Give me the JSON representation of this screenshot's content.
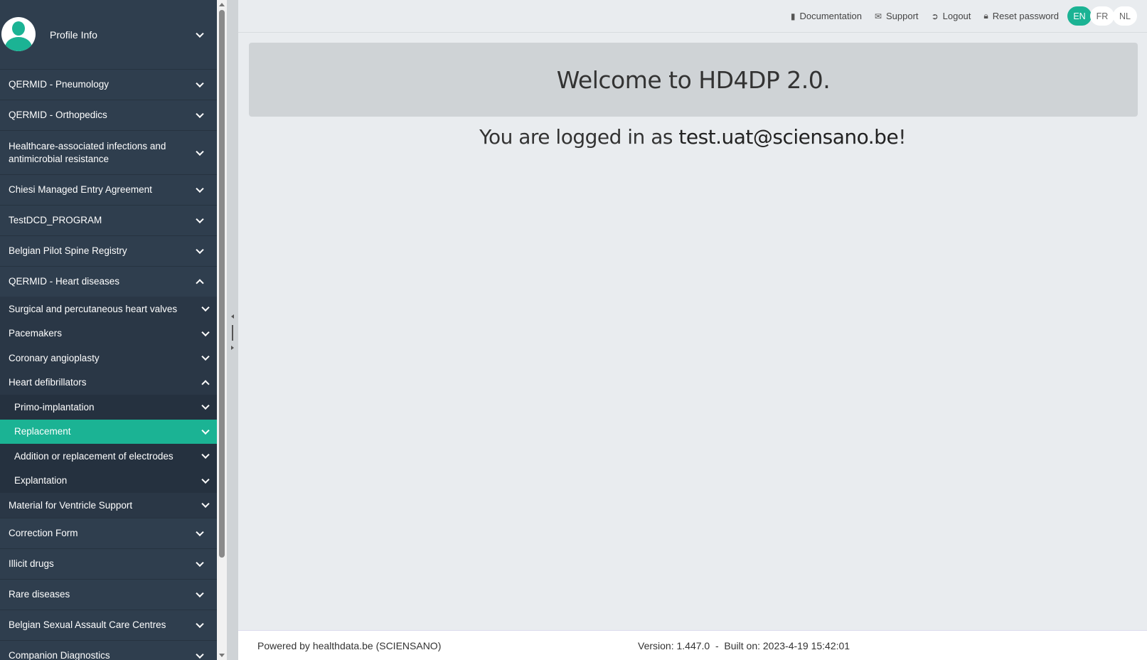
{
  "sidebar": {
    "profile_label": "Profile Info",
    "menu": [
      {
        "label": "QERMID - Pneumology"
      },
      {
        "label": "QERMID - Orthopedics"
      },
      {
        "label": "Healthcare-associated infections and antimicrobial resistance"
      },
      {
        "label": "Chiesi Managed Entry Agreement"
      },
      {
        "label": "TestDCD_PROGRAM"
      },
      {
        "label": "Belgian Pilot Spine Registry"
      },
      {
        "label": "QERMID - Heart diseases"
      }
    ],
    "heart_sub": [
      {
        "label": "Surgical and percutaneous heart valves"
      },
      {
        "label": "Pacemakers"
      },
      {
        "label": "Coronary angioplasty"
      },
      {
        "label": "Heart defibrillators"
      }
    ],
    "defib_sub": [
      {
        "label": "Primo-implantation"
      },
      {
        "label": "Replacement"
      },
      {
        "label": "Addition or replacement of electrodes"
      },
      {
        "label": "Explantation"
      }
    ],
    "heart_sub_after": [
      {
        "label": "Material for Ventricle Support"
      }
    ],
    "menu_after": [
      {
        "label": "Correction Form"
      },
      {
        "label": "Illicit drugs"
      },
      {
        "label": "Rare diseases"
      },
      {
        "label": "Belgian Sexual Assault Care Centres"
      },
      {
        "label": "Companion Diagnostics"
      }
    ],
    "active_item": "Replacement"
  },
  "topbar": {
    "documentation": "Documentation",
    "support": "Support",
    "logout": "Logout",
    "reset_password": "Reset password",
    "languages": [
      "EN",
      "FR",
      "NL"
    ],
    "active_language": "EN"
  },
  "main": {
    "welcome": "Welcome to HD4DP 2.0.",
    "logged_prefix": "You are logged in as ",
    "user_email": "test.uat@sciensano.be",
    "logged_suffix": "!"
  },
  "footer": {
    "powered_by": "Powered by healthdata.be (SCIENSANO)",
    "version": "Version: 1.447.0  -  Built on: 2023-4-19 15:42:01"
  },
  "colors": {
    "sidebar_bg": "#2f3e4e",
    "accent": "#1bb394",
    "main_bg": "#e9ecef"
  }
}
